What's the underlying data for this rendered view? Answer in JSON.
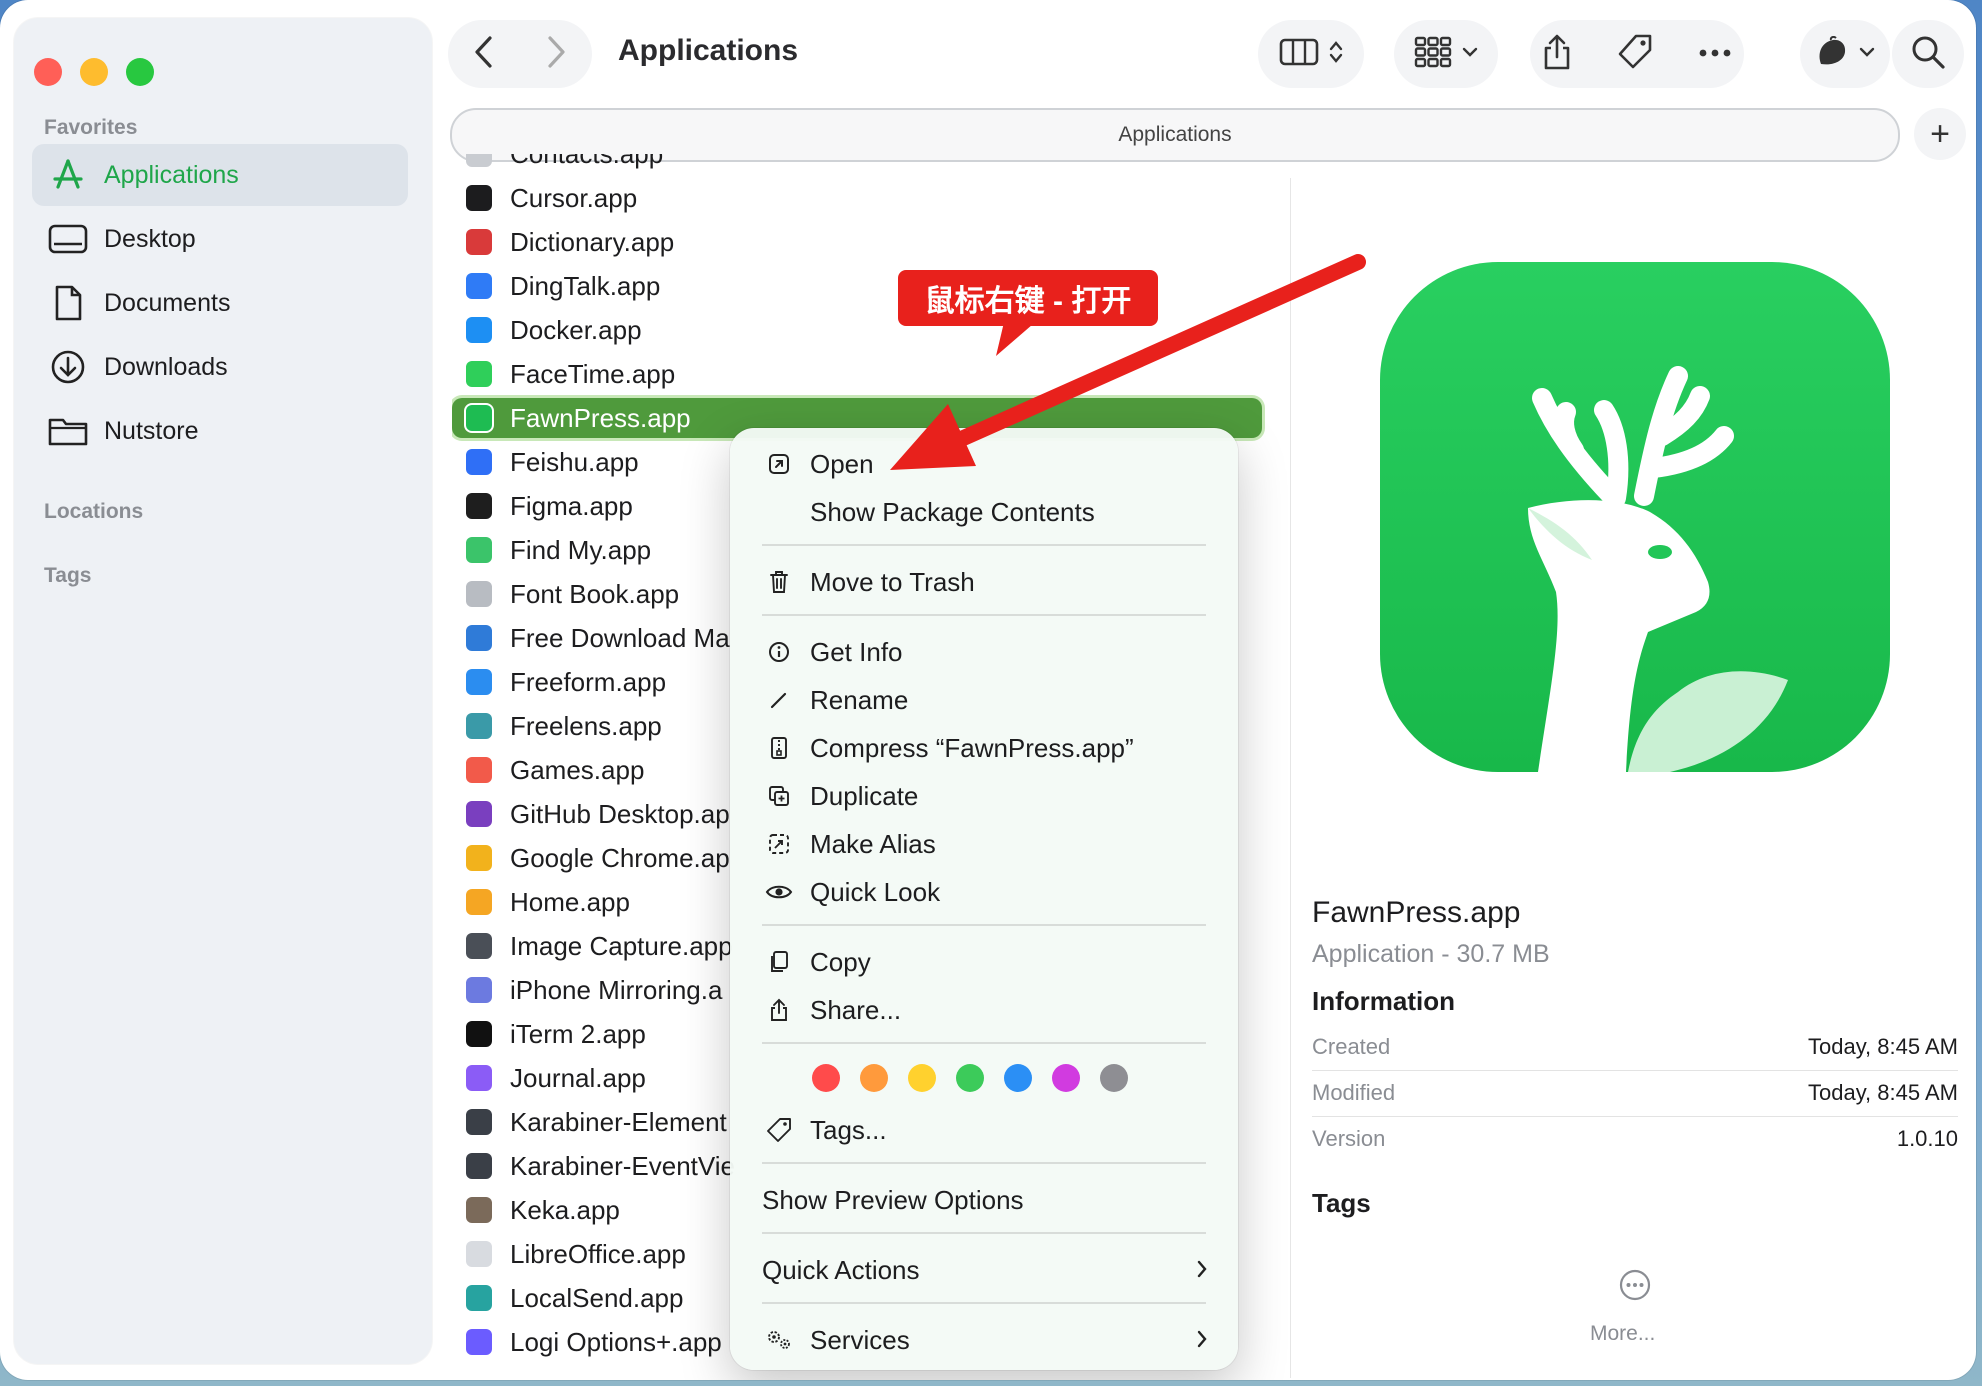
{
  "window": {
    "title": "Applications"
  },
  "sidebar": {
    "favorites_label": "Favorites",
    "items": [
      {
        "label": "Applications",
        "icon": "applications-icon",
        "active": true
      },
      {
        "label": "Desktop",
        "icon": "desktop-icon"
      },
      {
        "label": "Documents",
        "icon": "document-icon"
      },
      {
        "label": "Downloads",
        "icon": "download-icon"
      },
      {
        "label": "Nutstore",
        "icon": "folder-icon"
      }
    ],
    "locations_label": "Locations",
    "tags_label": "Tags"
  },
  "pathbar": {
    "label": "Applications"
  },
  "files": [
    {
      "name": "Contacts.app",
      "color": "#c9ccd1"
    },
    {
      "name": "Cursor.app",
      "color": "#1c1c1e"
    },
    {
      "name": "Dictionary.app",
      "color": "#d93a3a"
    },
    {
      "name": "DingTalk.app",
      "color": "#2f7bf6"
    },
    {
      "name": "Docker.app",
      "color": "#1d8ff3"
    },
    {
      "name": "FaceTime.app",
      "color": "#2fcf5a"
    },
    {
      "name": "FawnPress.app",
      "color": "#1ebc52",
      "selected": true
    },
    {
      "name": "Feishu.app",
      "color": "#2f6ff6"
    },
    {
      "name": "Figma.app",
      "color": "#1e1e1e"
    },
    {
      "name": "Find My.app",
      "color": "#3bc46a"
    },
    {
      "name": "Font Book.app",
      "color": "#b8bcc2"
    },
    {
      "name": "Free Download Ma",
      "color": "#2f7bd8"
    },
    {
      "name": "Freeform.app",
      "color": "#2b8df0"
    },
    {
      "name": "Freelens.app",
      "color": "#3a9aa8"
    },
    {
      "name": "Games.app",
      "color": "#f25a4a"
    },
    {
      "name": "GitHub Desktop.ap",
      "color": "#7a3fbf"
    },
    {
      "name": "Google Chrome.ap",
      "color": "#f2b21c"
    },
    {
      "name": "Home.app",
      "color": "#f5a623"
    },
    {
      "name": "Image Capture.app",
      "color": "#4a4f57"
    },
    {
      "name": "iPhone Mirroring.a",
      "color": "#6c7ae0"
    },
    {
      "name": "iTerm 2.app",
      "color": "#111111"
    },
    {
      "name": "Journal.app",
      "color": "#8b5cf6"
    },
    {
      "name": "Karabiner-Element",
      "color": "#3a3f47"
    },
    {
      "name": "Karabiner-EventVie",
      "color": "#3a3f47"
    },
    {
      "name": "Keka.app",
      "color": "#7b6a5a"
    },
    {
      "name": "LibreOffice.app",
      "color": "#d8dbe0"
    },
    {
      "name": "LocalSend.app",
      "color": "#27a3a0"
    },
    {
      "name": "Logi Options+.app",
      "color": "#6b5cff"
    }
  ],
  "context_menu": {
    "open": "Open",
    "show_package": "Show Package Contents",
    "trash": "Move to Trash",
    "get_info": "Get Info",
    "rename": "Rename",
    "compress": "Compress “FawnPress.app”",
    "duplicate": "Duplicate",
    "make_alias": "Make Alias",
    "quick_look": "Quick Look",
    "copy": "Copy",
    "share": "Share...",
    "tags": "Tags...",
    "preview_options": "Show Preview Options",
    "quick_actions": "Quick Actions",
    "services": "Services",
    "tag_colors": [
      "#ff4b4b",
      "#ff9a3c",
      "#ffd12e",
      "#3ccb5a",
      "#2b8ff5",
      "#d13be0",
      "#8e8e93"
    ]
  },
  "annotation": {
    "label": "鼠标右键 - 打开",
    "color": "#e8211c"
  },
  "preview": {
    "name": "FawnPress.app",
    "kind": "Application - 30.7 MB",
    "info_label": "Information",
    "rows": [
      {
        "key": "Created",
        "value": "Today, 8:45 AM"
      },
      {
        "key": "Modified",
        "value": "Today, 8:45 AM"
      },
      {
        "key": "Version",
        "value": "1.0.10"
      }
    ],
    "tags_label": "Tags",
    "more_label": "More...",
    "brand_color": "#21c657"
  }
}
